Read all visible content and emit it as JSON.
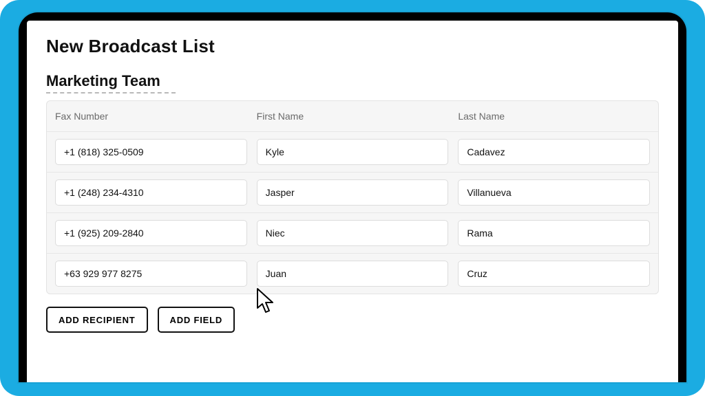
{
  "page": {
    "title": "New Broadcast List",
    "list_name": "Marketing Team"
  },
  "columns": [
    {
      "label": "Fax Number"
    },
    {
      "label": "First Name"
    },
    {
      "label": "Last Name"
    }
  ],
  "rows": [
    {
      "fax": "+1 (818) 325-0509",
      "first": "Kyle",
      "last": "Cadavez"
    },
    {
      "fax": "+1 (248) 234-4310",
      "first": "Jasper",
      "last": "Villanueva"
    },
    {
      "fax": "+1 (925) 209-2840",
      "first": "Niec",
      "last": "Rama"
    },
    {
      "fax": "+63 929 977 8275",
      "first": "Juan",
      "last": "Cruz"
    }
  ],
  "actions": {
    "add_recipient": "ADD RECIPIENT",
    "add_field": "ADD FIELD"
  }
}
